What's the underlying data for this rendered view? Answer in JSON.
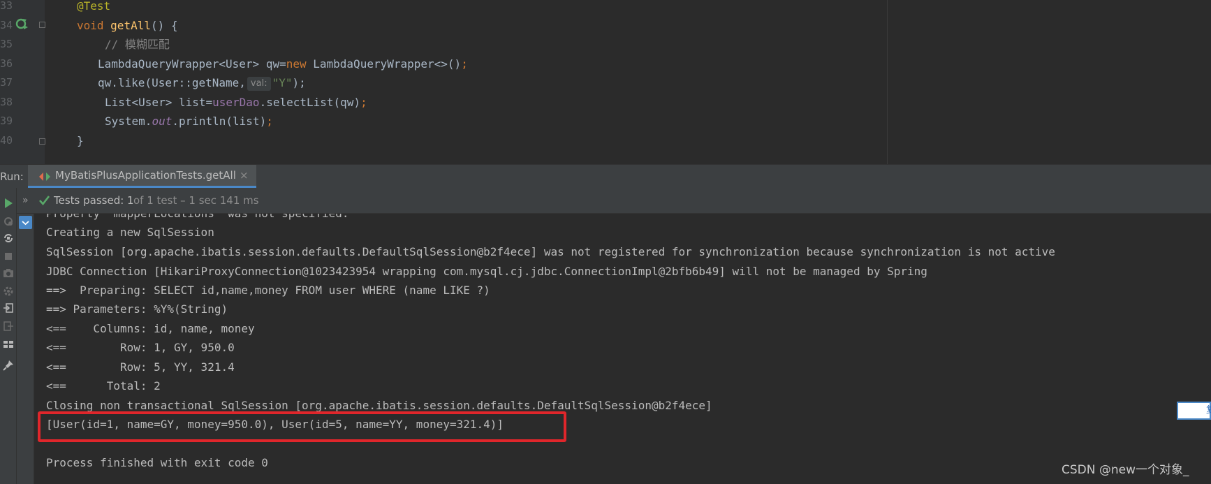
{
  "editor": {
    "lines": [
      {
        "num": "33",
        "code": "@Test"
      },
      {
        "num": "34",
        "code": "void getAll() {"
      },
      {
        "num": "35",
        "code": "// 模糊匹配"
      },
      {
        "num": "36",
        "code": "LambdaQueryWrapper<User> qw=new LambdaQueryWrapper<>();"
      },
      {
        "num": "37",
        "code": "qw.like(User::getName, val: \"Y\");"
      },
      {
        "num": "38",
        "code": "List<User> list=userDao.selectList(qw);"
      },
      {
        "num": "39",
        "code": "System.out.println(list);"
      },
      {
        "num": "40",
        "code": "}"
      }
    ],
    "tokens": {
      "annotation": "@Test",
      "void_kw": "void",
      "method_name": "getAll",
      "method_tail": "() {",
      "comment": "// 模糊匹配",
      "wrapper_decl": "LambdaQueryWrapper<User> qw=",
      "new_kw": "new",
      "wrapper_ctor": " LambdaQueryWrapper<>()",
      "semicolon": ";",
      "like_call": "qw.like(User::getName,",
      "param_hint": "val:",
      "like_arg": "\"Y\"",
      "like_tail": ");",
      "list_decl": "List<User> list=",
      "dao_field": "userDao",
      "select_call": ".selectList(qw)",
      "system": "System.",
      "out_field": "out",
      "println_call": ".println(list)",
      "close_brace": "}"
    }
  },
  "run_panel": {
    "label": "Run:",
    "tab_label": "MyBatisPlusApplicationTests.getAll",
    "tab_close": "×",
    "status_chevron": "»",
    "status_passed": "Tests passed: 1",
    "status_detail": "of 1 test – 1 sec 141 ms"
  },
  "console": {
    "lines": [
      "Property 'mapperLocations' was not specified.",
      "Creating a new SqlSession",
      "SqlSession [org.apache.ibatis.session.defaults.DefaultSqlSession@b2f4ece] was not registered for synchronization because synchronization is not active",
      "JDBC Connection [HikariProxyConnection@1023423954 wrapping com.mysql.cj.jdbc.ConnectionImpl@2bfb6b49] will not be managed by Spring",
      "==>  Preparing: SELECT id,name,money FROM user WHERE (name LIKE ?)",
      "==> Parameters: %Y%(String)",
      "<==    Columns: id, name, money",
      "<==        Row: 1, GY, 950.0",
      "<==        Row: 5, YY, 321.4",
      "<==      Total: 2",
      "Closing non transactional SqlSession [org.apache.ibatis.session.defaults.DefaultSqlSession@b2f4ece]",
      "[User(id=1, name=GY, money=950.0), User(id=5, name=YY, money=321.4)]",
      "",
      "Process finished with exit code 0"
    ]
  },
  "side_chip": {
    "text": "复"
  },
  "watermark": "CSDN @new一个对象_",
  "icons": {
    "run_gutter": "rerun-test-icon",
    "tab": "test-tab-icon",
    "check": "check-icon"
  },
  "colors": {
    "accent": "#4a88c7",
    "passed": "#59a869",
    "highlight": "#e0262b"
  }
}
